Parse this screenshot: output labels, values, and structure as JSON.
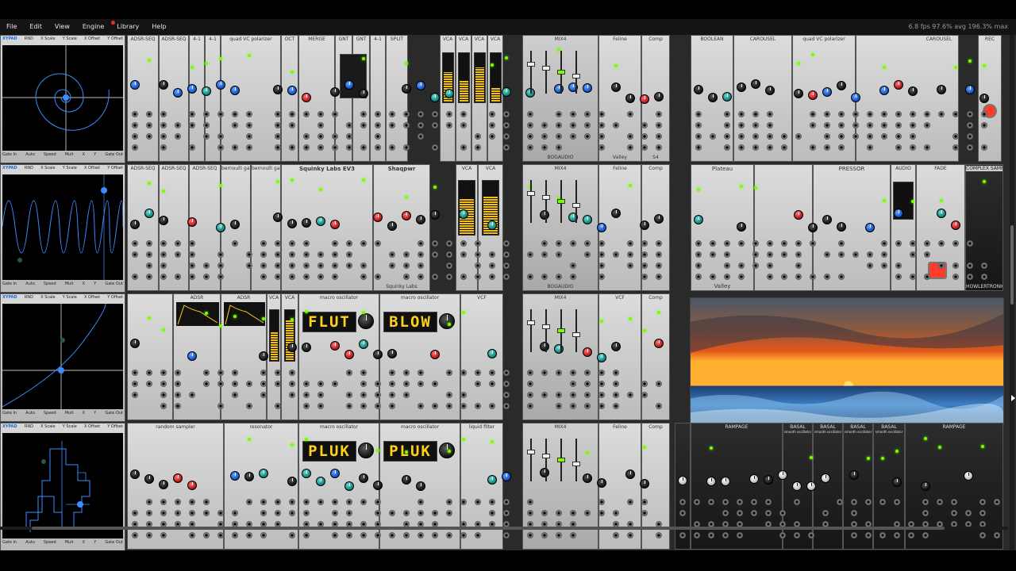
{
  "menu": {
    "items": [
      "File",
      "Edit",
      "View",
      "Engine",
      "Library",
      "Help"
    ],
    "status": "6.8 fps   97.6% avg   196.3% max"
  },
  "scopes": [
    {
      "title": "XYPAD",
      "controls": [
        "RND",
        "X Scale",
        "Y Scale",
        "X Offset",
        "Y Offset"
      ],
      "footer": [
        "Gate In",
        "Auto",
        "Speed",
        "Mult",
        "X",
        "Y",
        "Gate Out"
      ],
      "curve": "spiral"
    },
    {
      "title": "XYPAD",
      "controls": [
        "RND",
        "X Scale",
        "Y Scale",
        "X Offset",
        "Y Offset"
      ],
      "footer": [
        "Gate In",
        "Auto",
        "Speed",
        "Mult",
        "X",
        "Y",
        "Gate Out"
      ],
      "curve": "sine"
    },
    {
      "title": "XYPAD",
      "controls": [
        "RND",
        "X Scale",
        "Y Scale",
        "X Offset",
        "Y Offset"
      ],
      "footer": [
        "Gate In",
        "Auto",
        "Speed",
        "Mult",
        "X",
        "Y",
        "Gate Out"
      ],
      "curve": "exp"
    },
    {
      "title": "XYPAD",
      "controls": [
        "RND",
        "X Scale",
        "Y Scale",
        "X Offset",
        "Y Offset"
      ],
      "footer": [
        "Gate In",
        "Auto",
        "Speed",
        "Mult",
        "X",
        "Y",
        "Gate Out"
      ],
      "curve": "steps"
    }
  ],
  "row1": {
    "titles": [
      "ADSR-SEQ",
      "ADSR-SEQ",
      "4-1",
      "4-1",
      "quad VC polarizer",
      "OCT",
      "MERGE",
      "GNT",
      "GNT",
      "4-1",
      "SPLIT",
      "VCA",
      "VCA",
      "VCA",
      "VCA",
      "MIX4",
      "Feline",
      "Comp",
      "BOOLEAN",
      "CAROUSEL",
      "quad VC polarizer",
      "CAROUSEL",
      "REC"
    ],
    "footer": [
      "VEV",
      "VEV",
      "BOGAUDIO",
      "Valley",
      "S4"
    ]
  },
  "row2": {
    "titles": [
      "ADSR-SEQ",
      "ADSR-SEQ",
      "ADSR-SEQ",
      "bernoulli gate",
      "bernoulli gate",
      "Squinky Labs EV3",
      "Shaqpwr",
      "VCA",
      "VCA",
      "MIX4",
      "Feline",
      "Comp",
      "Plateau",
      "PRESSOR",
      "AUDIO",
      "FADE",
      "COMPLEX SAMPLER"
    ],
    "footer": [
      "Squinky Labs",
      "BOGAUDIO",
      "Valley",
      "HOWLERTRONIC"
    ]
  },
  "row3": {
    "titles": [
      "ADSR",
      "ADSR",
      "VCA",
      "VCA",
      "macro oscillator",
      "macro oscillator",
      "VCF",
      "MIX4",
      "VCF",
      "Comp"
    ],
    "displays": [
      "FLUT",
      "BLOW"
    ]
  },
  "row4": {
    "titles": [
      "random sampler",
      "resonator",
      "macro oscillator",
      "macro oscillator",
      "liquid filter",
      "MIX4",
      "Feline",
      "Comp",
      "RAMPAGE",
      "BASAL",
      "BASAL",
      "BASAL",
      "BASAL",
      "RAMPAGE"
    ],
    "displays": [
      "PLUK",
      "PLUK"
    ],
    "basal_sub": "smooth oscillator"
  },
  "colors": {
    "accent_yellow": "#ffd11a",
    "scope_trace": "#3d8bff",
    "record_red": "#ff3b2b",
    "led_green": "#77ff00"
  }
}
